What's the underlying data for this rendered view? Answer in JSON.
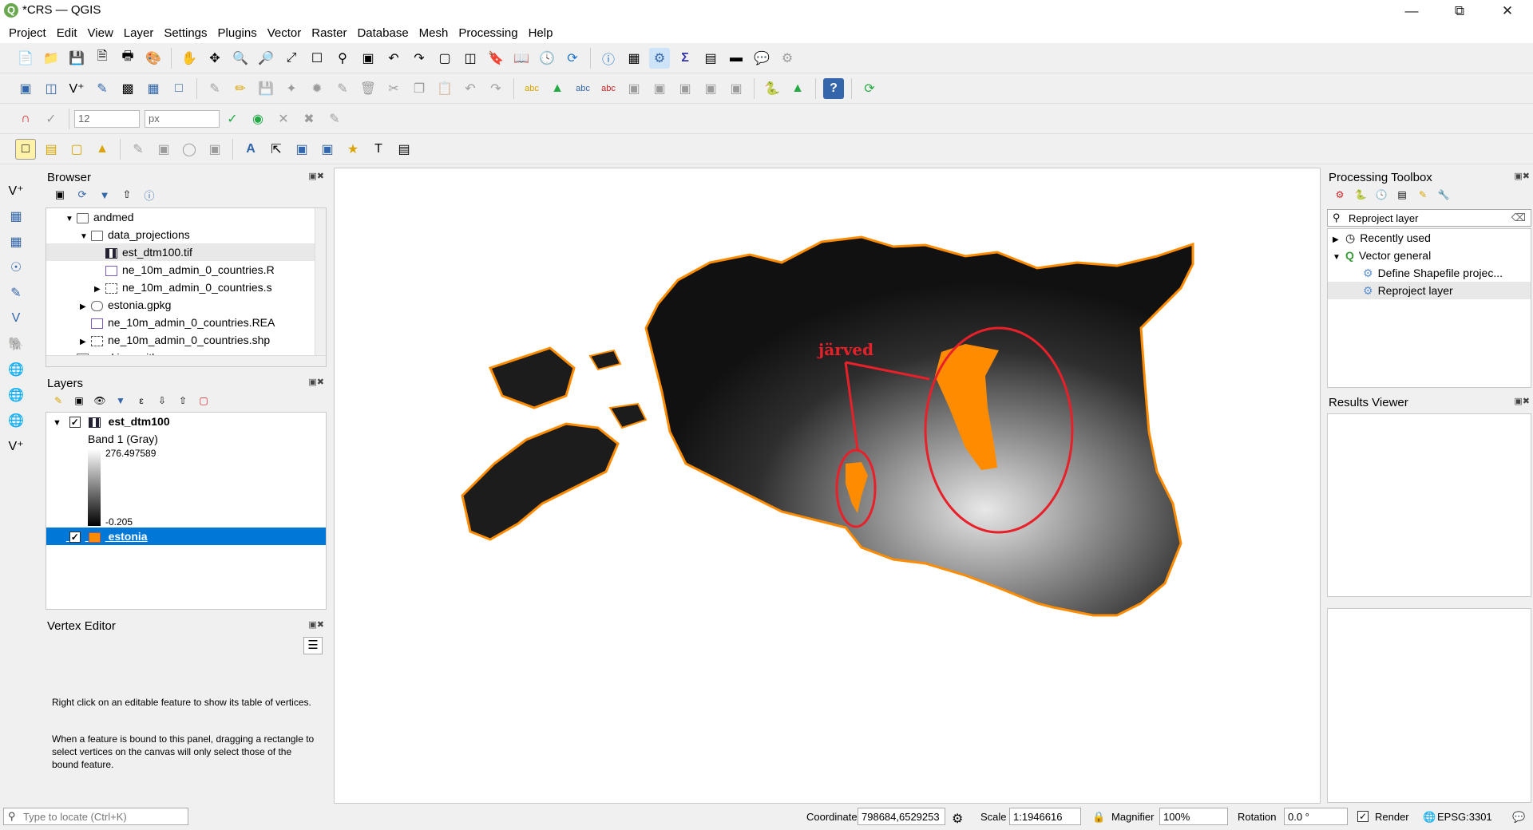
{
  "window": {
    "title": "*CRS — QGIS",
    "logo": "Q",
    "minimize": "—",
    "maximize": "⧉",
    "close": "✕"
  },
  "menu": [
    "Project",
    "Edit",
    "View",
    "Layer",
    "Settings",
    "Plugins",
    "Vector",
    "Raster",
    "Database",
    "Mesh",
    "Processing",
    "Help"
  ],
  "digitizing": {
    "snap_tolerance": "12",
    "snap_unit": "px"
  },
  "browser": {
    "title": "Browser",
    "items": [
      {
        "label": "andmed",
        "indent": 1,
        "kind": "folder",
        "expanded": true
      },
      {
        "label": "data_projections",
        "indent": 2,
        "kind": "folder",
        "expanded": true
      },
      {
        "label": "est_dtm100.tif",
        "indent": 3,
        "kind": "raster",
        "selected": true
      },
      {
        "label": "ne_10m_admin_0_countries.R",
        "indent": 3,
        "kind": "file"
      },
      {
        "label": "ne_10m_admin_0_countries.s",
        "indent": 3,
        "kind": "vector",
        "expandable": true
      },
      {
        "label": "estonia.gpkg",
        "indent": 2,
        "kind": "db",
        "expandable": true
      },
      {
        "label": "ne_10m_admin_0_countries.REA",
        "indent": 2,
        "kind": "file"
      },
      {
        "label": "ne_10m_admin_0_countries.shp",
        "indent": 2,
        "kind": "vector",
        "expandable": true
      },
      {
        "label": "working_with_crs",
        "indent": 1,
        "kind": "folder"
      }
    ]
  },
  "layers": {
    "title": "Layers",
    "raster": {
      "name": "est_dtm100",
      "band": "Band 1 (Gray)",
      "max": "276.497589",
      "min": "-0.205"
    },
    "vector": {
      "name": "estonia",
      "color": "#ff8c00"
    }
  },
  "vertex_editor": {
    "title": "Vertex Editor",
    "text1": "Right click on an editable feature to show its table of vertices.",
    "text2": "When a feature is bound to this panel, dragging a rectangle to select vertices on the canvas will only select those of the bound feature."
  },
  "map": {
    "annotation": "järved"
  },
  "processing": {
    "title": "Processing Toolbox",
    "search": "Reproject layer",
    "items": [
      {
        "label": "Recently used",
        "indent": 0,
        "kind": "clock",
        "expandable": true
      },
      {
        "label": "Vector general",
        "indent": 0,
        "kind": "qgis",
        "expanded": true
      },
      {
        "label": "Define Shapefile projec...",
        "indent": 1,
        "kind": "gear"
      },
      {
        "label": "Reproject layer",
        "indent": 1,
        "kind": "gear",
        "selected": true
      }
    ]
  },
  "results": {
    "title": "Results Viewer"
  },
  "status": {
    "locate_placeholder": "Type to locate (Ctrl+K)",
    "coordinate_label": "Coordinate",
    "coordinate": "798684,6529253",
    "scale_label": "Scale",
    "scale": "1:1946616",
    "magnifier_label": "Magnifier",
    "magnifier": "100%",
    "rotation_label": "Rotation",
    "rotation": "0.0 °",
    "render_label": "Render",
    "crs": "EPSG:3301"
  },
  "colors": {
    "accent": "#0078d7",
    "lake": "#ff8c00",
    "annotation": "#e8202a"
  }
}
